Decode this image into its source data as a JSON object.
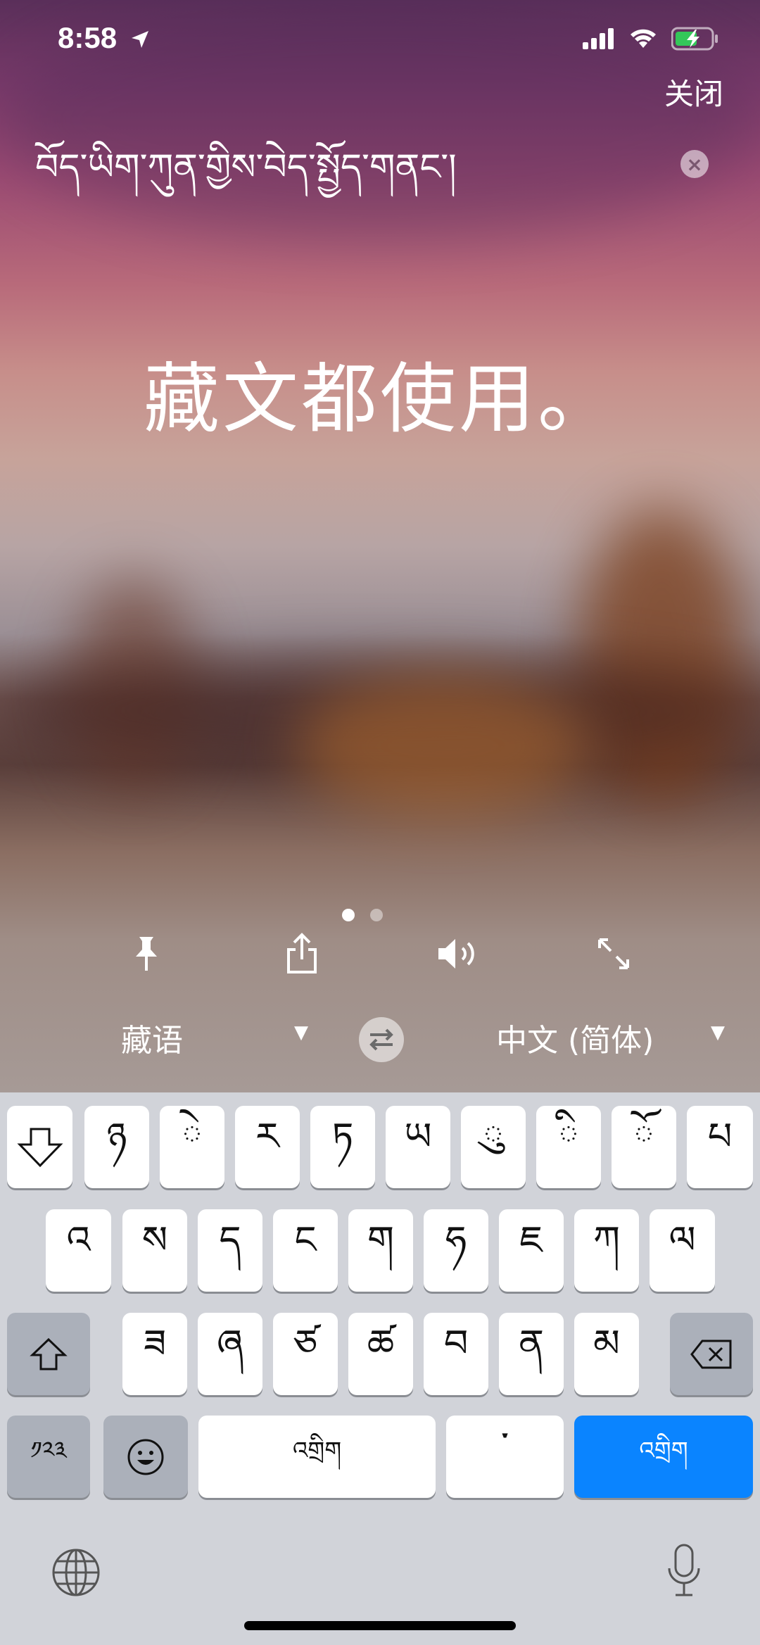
{
  "status_bar": {
    "time": "8:58"
  },
  "header": {
    "close_label": "关闭"
  },
  "source": {
    "text": "བོད་ཡིག་ཀུན་གྱིས་བེད་སྤྱོད་གནང་།"
  },
  "translation": {
    "text": "藏文都使用。"
  },
  "pagination": {
    "pages": 2,
    "active_page": 1
  },
  "actions": [
    "pin-icon",
    "share-icon",
    "speaker-icon",
    "expand-icon"
  ],
  "languages": {
    "source": "藏语",
    "target": "中文 (简体)"
  },
  "keyboard": {
    "row1": [
      "ཉ",
      "ེ",
      "ར",
      "ཏ",
      "ཡ",
      "ུ",
      "ི",
      "ོ",
      "པ"
    ],
    "row2": [
      "འ",
      "ས",
      "ད",
      "ང",
      "ག",
      "ཧ",
      "ཇ",
      "ཀ",
      "ལ"
    ],
    "row3": [
      "ཟ",
      "ཞ",
      "ཙ",
      "ཚ",
      "བ",
      "ན",
      "མ"
    ],
    "numbers_key": "༡༢༣",
    "space_label": "འགྲིག",
    "tsheg_key": "་",
    "return_label": "འགྲིག"
  },
  "colors": {
    "accent": "#0a84ff",
    "keyboard_bg": "#d1d3d9"
  }
}
